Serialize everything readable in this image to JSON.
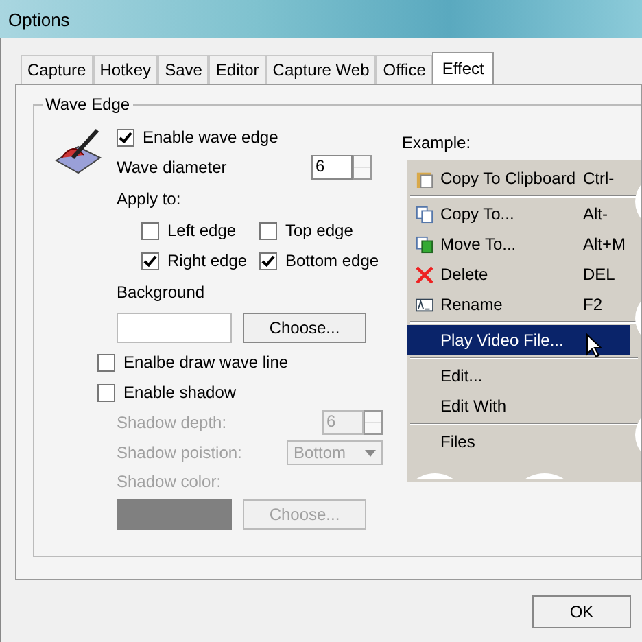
{
  "window": {
    "title": "Options"
  },
  "tabs": [
    {
      "label": "Capture",
      "selected": false
    },
    {
      "label": "Hotkey",
      "selected": false
    },
    {
      "label": "Save",
      "selected": false
    },
    {
      "label": "Editor",
      "selected": false
    },
    {
      "label": "Capture Web",
      "selected": false
    },
    {
      "label": "Office",
      "selected": false
    },
    {
      "label": "Effect",
      "selected": true
    }
  ],
  "group": {
    "title": "Wave Edge"
  },
  "enable_wave_edge": {
    "label": "Enable wave edge",
    "checked": true
  },
  "wave_diameter": {
    "label": "Wave diameter",
    "value": "6"
  },
  "apply_to": {
    "label": "Apply to:",
    "options": [
      {
        "label": "Left edge",
        "checked": false
      },
      {
        "label": "Top edge",
        "checked": false
      },
      {
        "label": "Right edge",
        "checked": true
      },
      {
        "label": "Bottom edge",
        "checked": true
      }
    ]
  },
  "background": {
    "label": "Background",
    "button": "Choose..."
  },
  "draw_wave_line": {
    "label": "Enalbe draw wave line",
    "checked": false
  },
  "shadow": {
    "label": "Enable shadow",
    "checked": false,
    "depth_label": "Shadow depth:",
    "depth": "6",
    "position_label": "Shadow poistion:",
    "position": "Bottom",
    "color_label": "Shadow color:",
    "button": "Choose..."
  },
  "example": {
    "label": "Example:",
    "items": [
      {
        "kind": "item",
        "label": "Copy To Clipboard",
        "shortcut": "Ctrl-",
        "selected": false
      },
      {
        "kind": "separator"
      },
      {
        "kind": "item",
        "label": "Copy To...",
        "shortcut": "Alt-",
        "selected": false
      },
      {
        "kind": "item",
        "label": "Move To...",
        "shortcut": "Alt+M",
        "selected": false
      },
      {
        "kind": "item",
        "label": "Delete",
        "shortcut": "DEL",
        "selected": false
      },
      {
        "kind": "item",
        "label": "Rename",
        "shortcut": "F2",
        "selected": false
      },
      {
        "kind": "separator"
      },
      {
        "kind": "item",
        "label": "Play Video File...",
        "selected": true
      },
      {
        "kind": "separator"
      },
      {
        "kind": "item",
        "label": "Edit...",
        "selected": false
      },
      {
        "kind": "item",
        "label": "Edit With",
        "selected": false
      },
      {
        "kind": "separator"
      },
      {
        "kind": "item",
        "label": "Files",
        "selected": false
      }
    ]
  },
  "buttons": {
    "ok": "OK"
  }
}
